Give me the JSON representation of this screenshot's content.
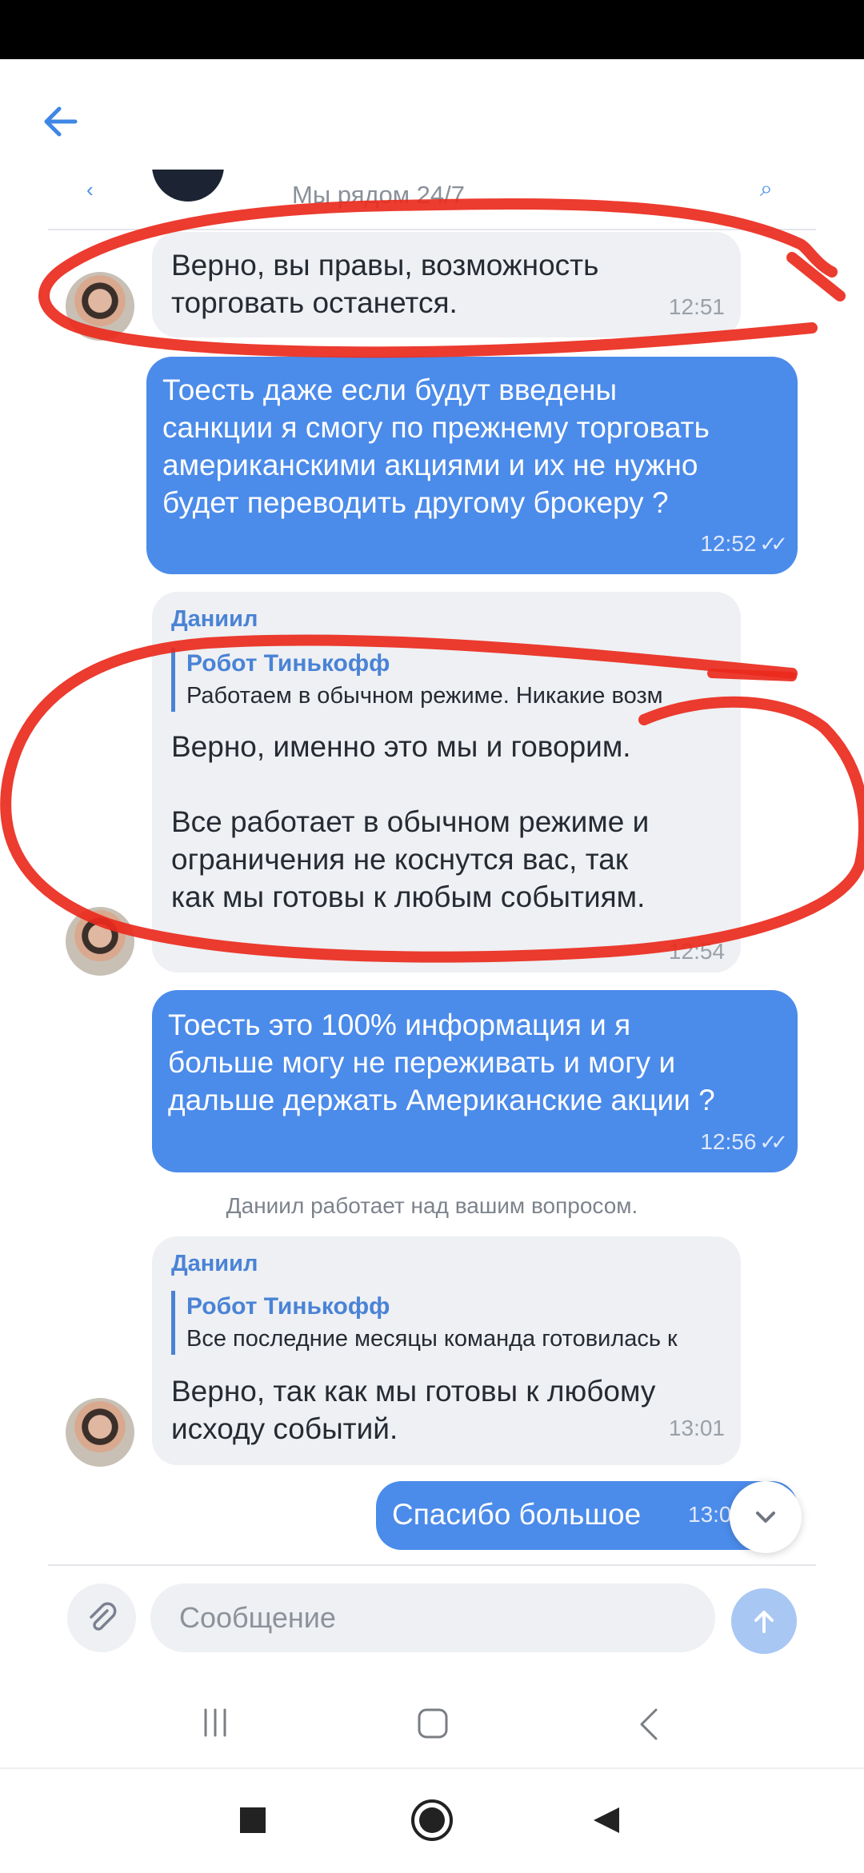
{
  "header": {
    "subtitle": "Мы рядом 24/7"
  },
  "messages": [
    {
      "text": "Верно, вы правы, возможность\nторговать останется.",
      "time": "12:51"
    },
    {
      "text": "Тоесть даже если будут введены\nсанкции я смогу по прежнему торговать\nамериканскими акциями и их не нужно\nбудет переводить другому брокеру ?",
      "time": "12:52"
    },
    {
      "sender": "Даниил",
      "quote_author": "Робот Тинькофф",
      "quote_text": "Работаем в обычном режиме. Никакие возм",
      "text": "Верно, именно это мы и говорим.\n\nВсе работает в обычном режиме и\nограничения не коснутся вас, так\nкак мы готовы к любым событиям.",
      "time": "12:54"
    },
    {
      "text": "Тоесть это 100% информация и я\nбольше могу не переживать и могу и\nдальше держать Американские акции ?",
      "time": "12:56"
    },
    {
      "sender": "Даниил",
      "quote_author": "Робот Тинькофф",
      "quote_text": "Все последние месяцы команда готовилась к",
      "text": "Верно, так как мы готовы к любому\nисходу событий.",
      "time": "13:01"
    },
    {
      "text": "Спасибо большое",
      "time": "13:0"
    }
  ],
  "system_message": "Даниил работает над вашим вопросом.",
  "composer": {
    "placeholder": "Сообщение"
  },
  "colors": {
    "accent": "#4b8bea",
    "annotation": "#ea2a1d"
  }
}
